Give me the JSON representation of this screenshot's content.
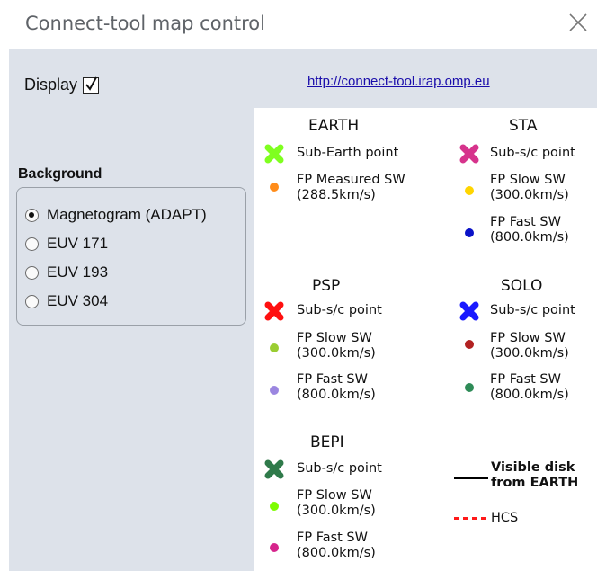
{
  "window": {
    "title": "Connect-tool map control",
    "close_icon": "close-icon"
  },
  "controls": {
    "display_label": "Display",
    "display_checked": true,
    "link_text": "http://connect-tool.irap.omp.eu",
    "background_label": "Background",
    "background_options": [
      "Magnetogram (ADAPT)",
      "EUV 171",
      "EUV 193",
      "EUV 304"
    ],
    "background_selected": "Magnetogram (ADAPT)"
  },
  "legend": {
    "earth": {
      "title": "EARTH",
      "sub_point": "Sub-Earth point",
      "fp_measured_1": "FP Measured SW",
      "fp_measured_2": "(288.5km/s)"
    },
    "sta": {
      "title": "STA",
      "sub_point": "Sub-s/c point",
      "slow_1": "FP Slow SW",
      "slow_2": "(300.0km/s)",
      "fast_1": "FP Fast SW",
      "fast_2": "(800.0km/s)"
    },
    "psp": {
      "title": "PSP",
      "sub_point": "Sub-s/c point",
      "slow_1": "FP Slow SW",
      "slow_2": "(300.0km/s)",
      "fast_1": "FP Fast SW",
      "fast_2": "(800.0km/s)"
    },
    "solo": {
      "title": "SOLO",
      "sub_point": "Sub-s/c point",
      "slow_1": "FP Slow SW",
      "slow_2": "(300.0km/s)",
      "fast_1": "FP Fast SW",
      "fast_2": "(800.0km/s)"
    },
    "bepi": {
      "title": "BEPI",
      "sub_point": "Sub-s/c point",
      "slow_1": "FP Slow SW",
      "slow_2": "(300.0km/s)",
      "fast_1": "FP Fast SW",
      "fast_2": "(800.0km/s)"
    },
    "visible_disk_1": "Visible disk",
    "visible_disk_2": "from EARTH",
    "hcs": "HCS"
  },
  "colors": {
    "earth_cross": "#7fff1f",
    "earth_measured": "#ff8c1a",
    "sta_cross": "#d6338c",
    "sta_slow": "#ffd500",
    "sta_fast": "#0a12c8",
    "psp_cross": "#ff1010",
    "psp_slow": "#9acd32",
    "psp_fast": "#9b86e0",
    "solo_cross": "#1a1aff",
    "solo_slow": "#b22222",
    "solo_fast": "#2e8b57",
    "bepi_cross": "#2f7a4a",
    "bepi_slow": "#7cfc00",
    "bepi_fast": "#d6248c",
    "hcs": "#ff1a1a"
  }
}
